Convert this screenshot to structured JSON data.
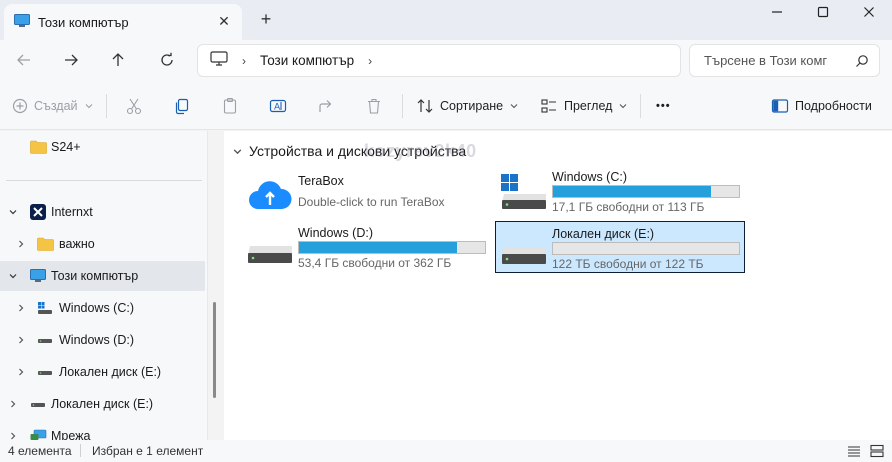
{
  "tab": {
    "title": "Този компютър",
    "close_glyph": "✕",
    "new_tab_glyph": "+"
  },
  "window_controls": {
    "minimize": "—",
    "maximize": "☐",
    "close": "✕"
  },
  "address": {
    "breadcrumb_label": "Този компютър",
    "separator": "›",
    "search_placeholder": "Търсене в Този комг"
  },
  "commands": {
    "new": "Създай",
    "sort": "Сортиране",
    "view": "Преглед",
    "more": "•••",
    "details": "Подробности"
  },
  "sidebar": {
    "items": [
      {
        "label": "S24+"
      },
      {
        "label": "Internxt"
      },
      {
        "label": "важно"
      },
      {
        "label": "Този компютър"
      },
      {
        "label": "Windows (C:)"
      },
      {
        "label": "Windows  (D:)"
      },
      {
        "label": "Локален диск (E:)"
      },
      {
        "label": "Локален диск (E:)"
      },
      {
        "label": "Мрежа"
      }
    ]
  },
  "main": {
    "group_title": "Устройства и дискови устройства",
    "watermark": "kozyrev2k40",
    "tiles": [
      {
        "name": "TeraBox",
        "subtitle": "Double-click to run TeraBox"
      },
      {
        "name": "Windows (C:)",
        "space": "17,1 ГБ свободни от 113 ГБ",
        "used_fraction": 0.85
      },
      {
        "name": "Windows  (D:)",
        "space": "53,4 ГБ свободни от 362 ГБ",
        "used_fraction": 0.85
      },
      {
        "name": "Локален диск (E:)",
        "space": "122 ТБ свободни от 122 ТБ",
        "used_fraction": 0.0
      }
    ]
  },
  "status": {
    "count": "4 елемента",
    "selection": "Избран е 1 елемент"
  },
  "colors": {
    "accent": "#26a0da",
    "selected_bg": "#cce8ff",
    "folder": "#f6c445",
    "terabox": "#1a8cff"
  }
}
